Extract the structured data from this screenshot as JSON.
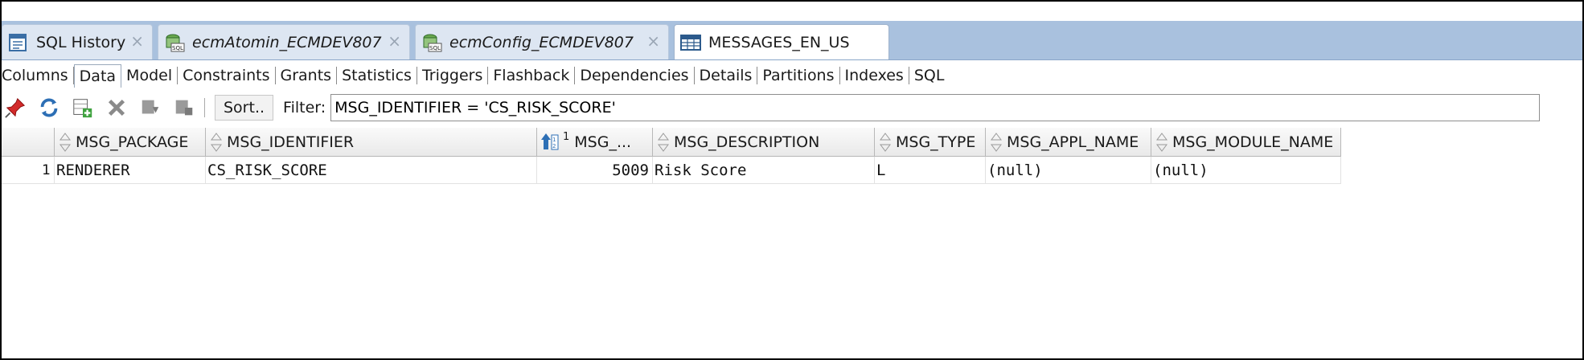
{
  "tabs": [
    {
      "label": "SQL History",
      "icon": "sql-history-icon",
      "italic": false
    },
    {
      "label": "ecmAtomin_ECMDEV807",
      "icon": "sql-worksheet-icon",
      "italic": true
    },
    {
      "label": "ecmConfig_ECMDEV807",
      "icon": "sql-worksheet-icon",
      "italic": true
    },
    {
      "label": "MESSAGES_EN_US",
      "icon": "table-icon",
      "italic": false
    }
  ],
  "close_glyph": "×",
  "subtabs": [
    "Columns",
    "Data",
    "Model",
    "Constraints",
    "Grants",
    "Statistics",
    "Triggers",
    "Flashback",
    "Dependencies",
    "Details",
    "Partitions",
    "Indexes",
    "SQL"
  ],
  "active_subtab": "Data",
  "toolbar": {
    "icons": [
      "pin-icon",
      "refresh-icon",
      "insert-row-icon",
      "delete-row-icon",
      "commit-icon",
      "rollback-icon"
    ],
    "sort_label": "Sort..",
    "filter_label": "Filter:",
    "filter_value": "MSG_IDENTIFIER = 'CS_RISK_SCORE'"
  },
  "grid": {
    "columns": [
      "MSG_PACKAGE",
      "MSG_IDENTIFIER",
      "MSG_...",
      "MSG_DESCRIPTION",
      "MSG_TYPE",
      "MSG_APPL_NAME",
      "MSG_MODULE_NAME"
    ],
    "sorted_column_badge": "1",
    "rows": [
      {
        "num": "1",
        "cells": [
          "RENDERER",
          "CS_RISK_SCORE",
          "5009",
          "Risk Score",
          "L",
          "(null)",
          "(null)"
        ]
      }
    ]
  },
  "colors": {
    "tabbar": "#a9c1de",
    "tab": "#dde6f2",
    "active_tab": "#ffffff"
  }
}
